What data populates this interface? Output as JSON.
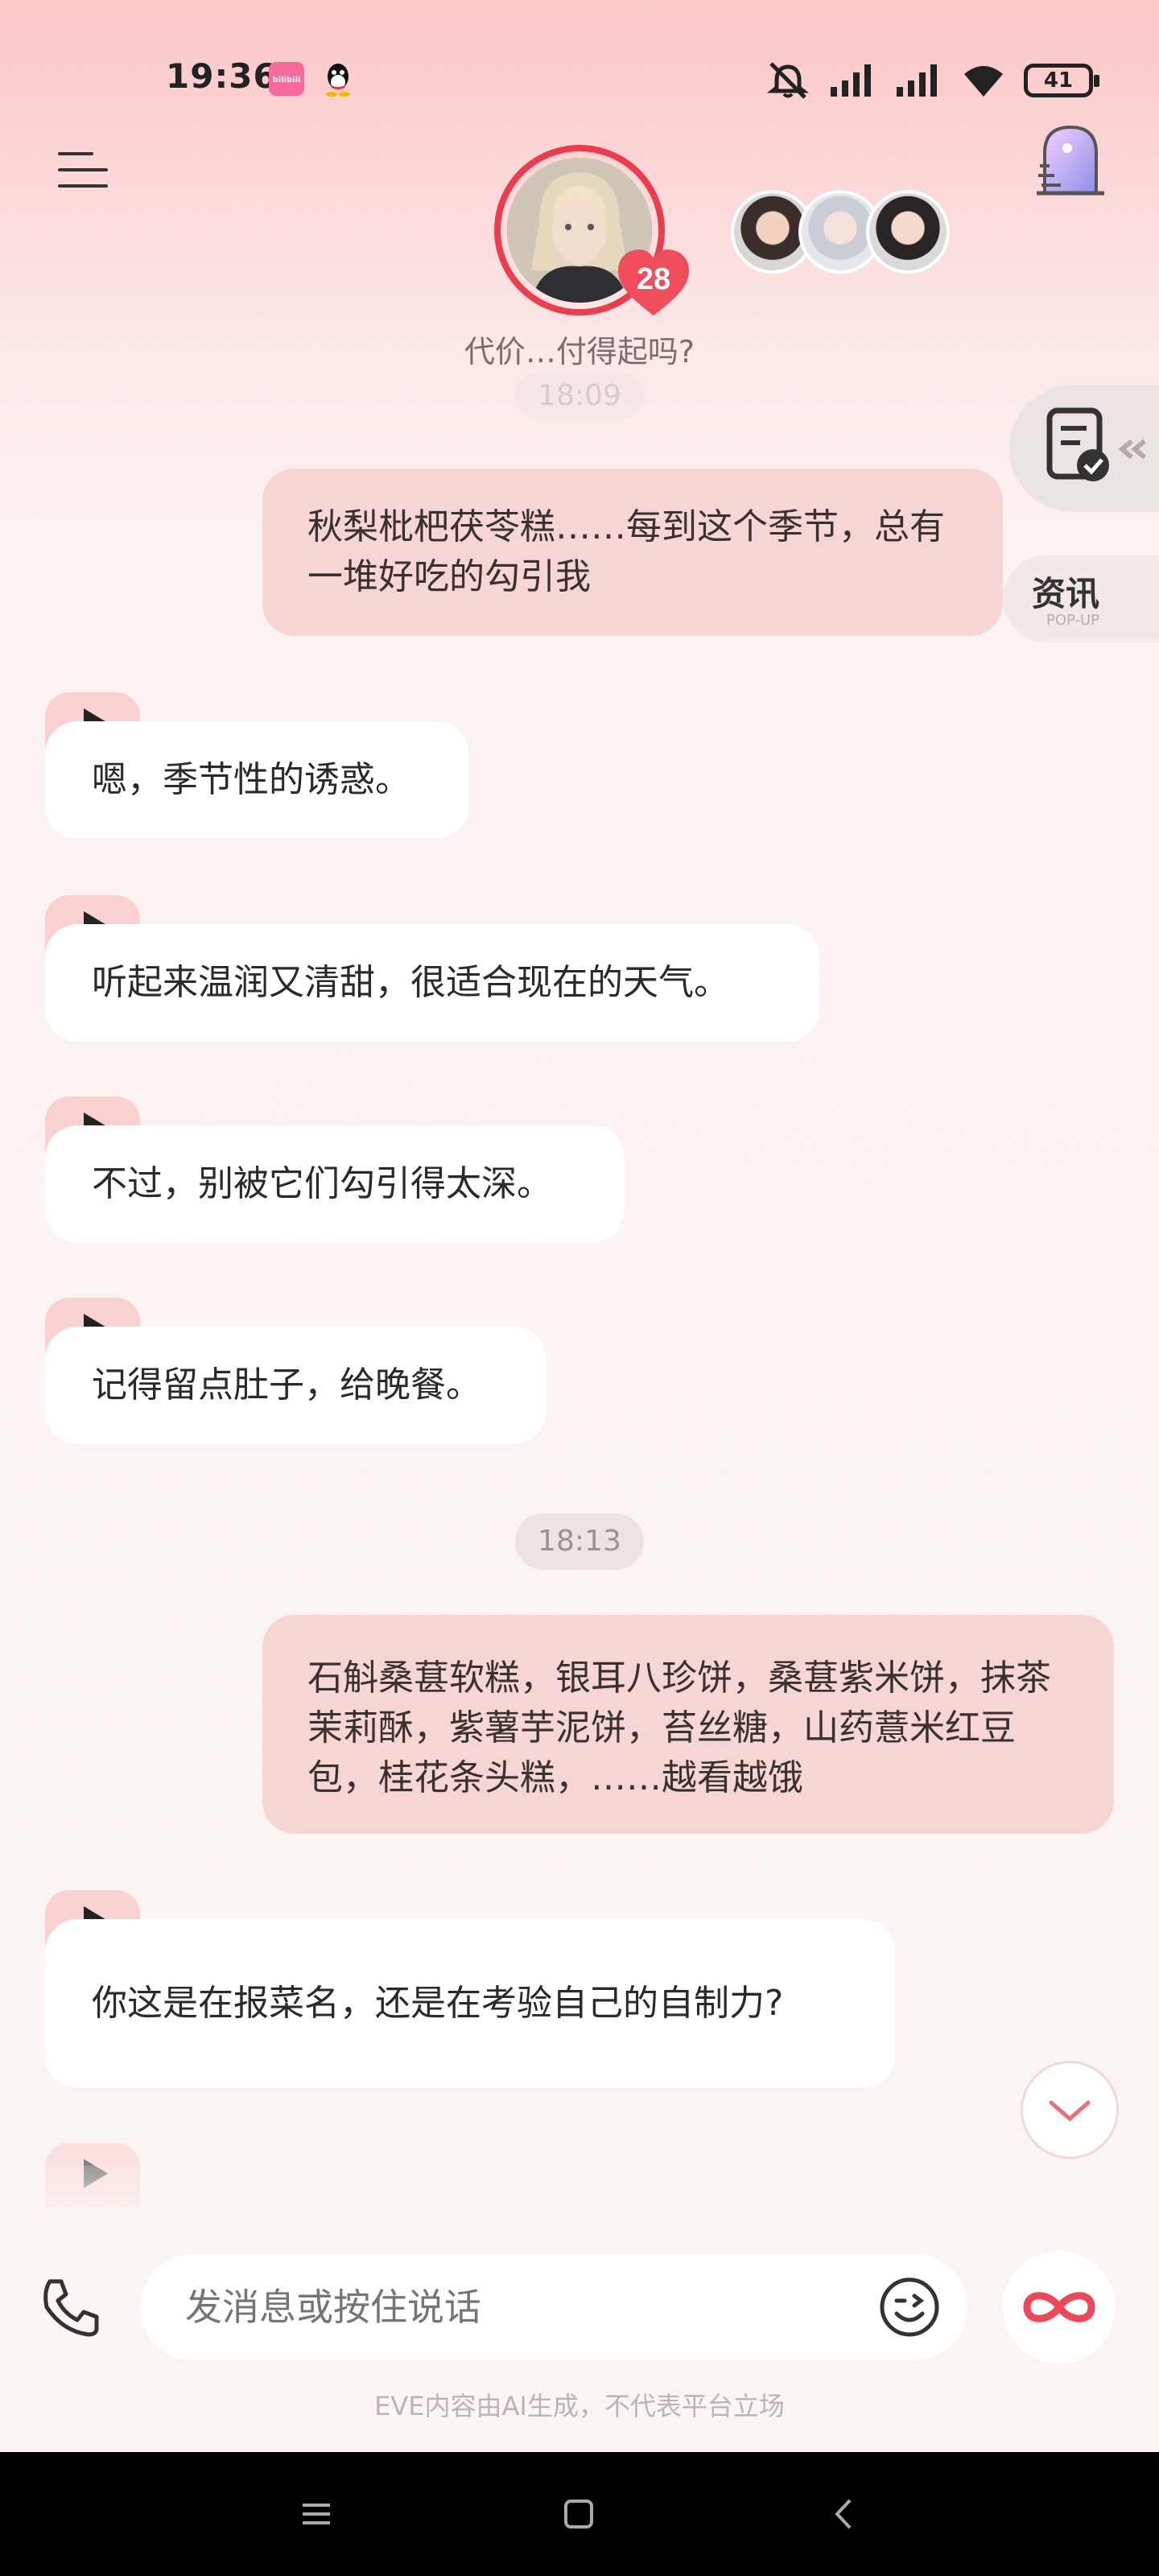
{
  "status_bar": {
    "time": "19:36",
    "app1_label": "bilibili",
    "battery": "41"
  },
  "header": {
    "tagline": "代价…付得起吗?",
    "affinity_level": "28"
  },
  "side_tools": {
    "news_title": "资讯",
    "news_subtitle": "POP-UP"
  },
  "messages": {
    "faded_time": "18:09",
    "user_1": "秋梨枇杷茯苓糕……每到这个季节，总有一堆好吃的勾引我",
    "ai_1": "嗯，季节性的诱惑。",
    "ai_2": "听起来温润又清甜，很适合现在的天气。",
    "ai_3": "不过，别被它们勾引得太深。",
    "ai_4": "记得留点肚子，给晚餐。",
    "time_2": "18:13",
    "user_2": "石斛桑葚软糕，银耳八珍饼，桑葚紫米饼，抹茶茉莉酥，紫薯芋泥饼，苔丝糖，山药薏米红豆包，桂花条头糕，……越看越饿",
    "ai_5": "你这是在报菜名，还是在考验自己的自制力?"
  },
  "input": {
    "placeholder": "发消息或按住说话"
  },
  "footer": {
    "disclaimer": "EVE内容由AI生成，不代表平台立场"
  },
  "colors": {
    "accent": "#ee3c4f",
    "user_bubble": "#f5d6d5",
    "play_tab": "#fbd0d0"
  }
}
